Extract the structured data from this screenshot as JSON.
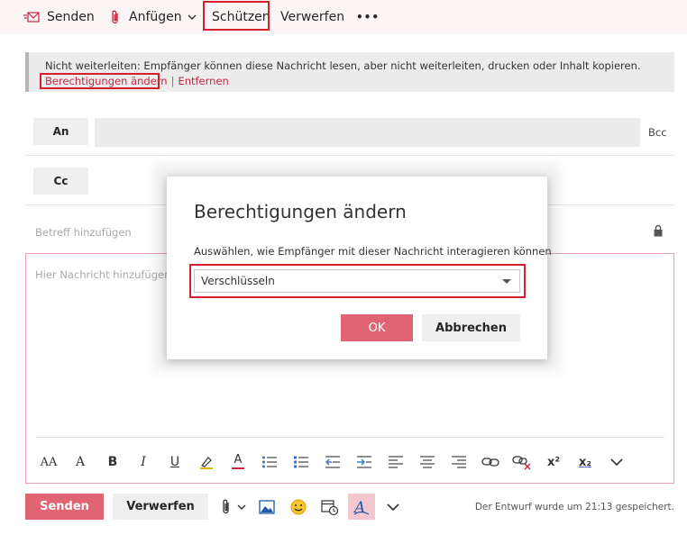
{
  "colors": {
    "accent": "#c8253d",
    "highlight": "#d3202f",
    "send": "#e06472"
  },
  "toolbar": {
    "send_label": "Senden",
    "attach_label": "Anfügen",
    "protect_label": "Schützen",
    "discard_label": "Verwerfen",
    "more_label": "•••",
    "icons": [
      "envelope-send-icon",
      "paperclip-icon",
      "chevron-down-icon",
      "more-icon"
    ]
  },
  "infobar": {
    "text": "Nicht weiterleiten: Empfänger können diese Nachricht lesen, aber nicht weiterleiten, drucken oder Inhalt kopieren.",
    "change_link": "Berechtigungen ändern",
    "separator": "|",
    "remove_link": "Entfernen"
  },
  "recipients": {
    "to_label": "An",
    "cc_label": "Cc",
    "bcc_label": "Bcc"
  },
  "subject": {
    "placeholder": "Betreff hinzufügen"
  },
  "body": {
    "placeholder": "Hier Nachricht hinzufügen o"
  },
  "format_toolbar": {
    "icons": [
      "font-size-icon",
      "grow-font-icon",
      "bold-icon",
      "italic-icon",
      "underline-icon",
      "highlight-icon",
      "font-color-icon",
      "bullets-icon",
      "numbering-icon",
      "decrease-indent-icon",
      "increase-indent-icon",
      "align-left-icon",
      "align-center-icon",
      "align-right-icon",
      "link-icon",
      "remove-link-icon",
      "superscript-icon",
      "subscript-icon",
      "chevron-down-icon"
    ],
    "bold": "B",
    "italic": "I",
    "underline": "U",
    "font_color": "A",
    "grow_font": "A",
    "font_size": "AA",
    "superscript": "x²",
    "subscript": "x₂"
  },
  "bottom": {
    "send_label": "Senden",
    "discard_label": "Verwerfen",
    "saved_text": "Der Entwurf wurde um 21:13 gespeichert.",
    "icons": [
      "paperclip-icon",
      "chevron-down-icon",
      "image-icon",
      "emoji-icon",
      "schedule-icon",
      "format-icon",
      "chevron-down-icon"
    ]
  },
  "dialog": {
    "title": "Berechtigungen ändern",
    "label": "Auswählen, wie Empfänger mit dieser Nachricht interagieren können",
    "selected_value": "Verschlüsseln",
    "ok_label": "OK",
    "cancel_label": "Abbrechen"
  }
}
